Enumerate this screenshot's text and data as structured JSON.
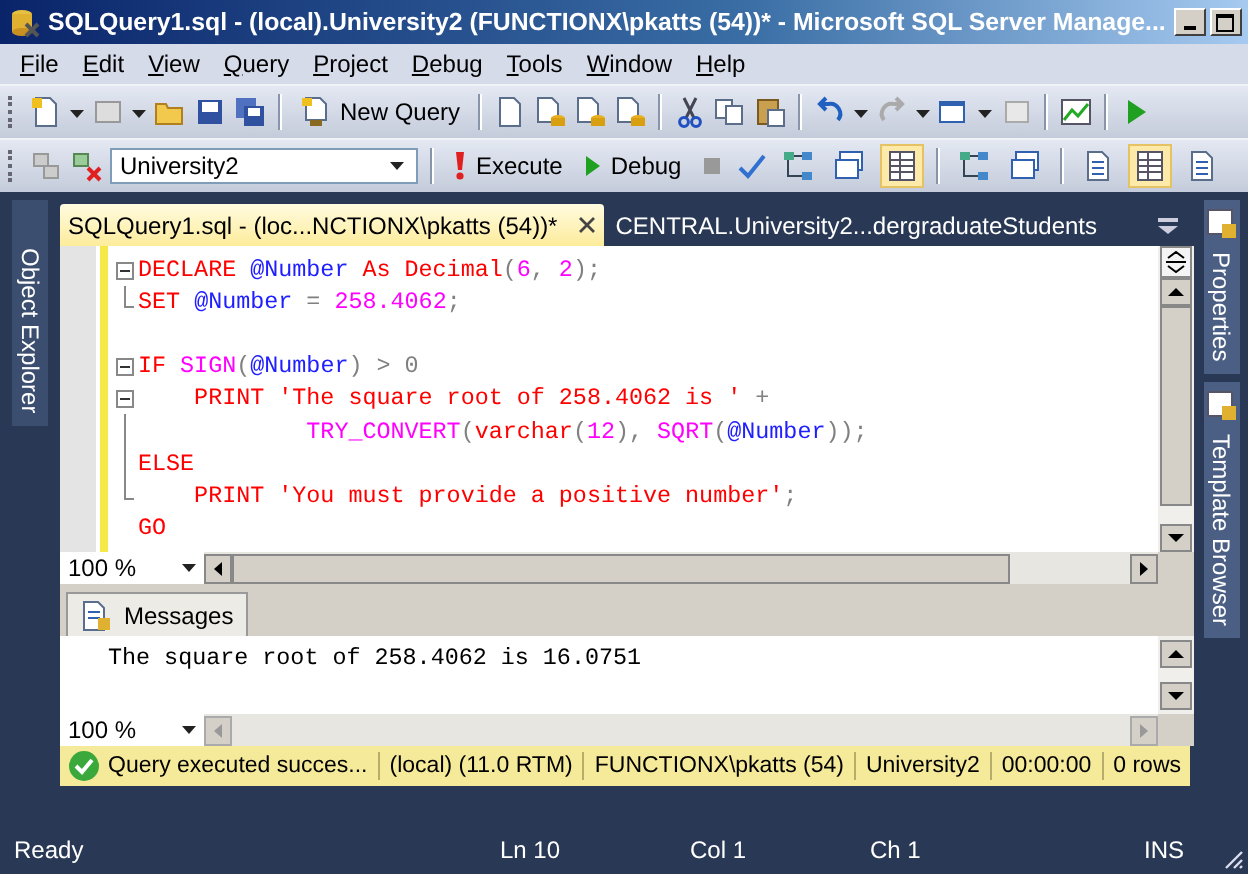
{
  "window": {
    "title": "SQLQuery1.sql - (local).University2 (FUNCTIONX\\pkatts (54))* - Microsoft SQL Server Manage..."
  },
  "menu": [
    "File",
    "Edit",
    "View",
    "Query",
    "Project",
    "Debug",
    "Tools",
    "Window",
    "Help"
  ],
  "toolbar_1": {
    "new_query": "New Query"
  },
  "toolbar_2": {
    "database": "University2",
    "execute": "Execute",
    "debug": "Debug",
    "toggles": [
      {
        "selected": false
      },
      {
        "selected": false
      },
      {
        "selected": true
      },
      {
        "selected": false
      },
      {
        "selected": false
      },
      {
        "selected": false
      },
      {
        "selected": true
      },
      {
        "selected": false
      }
    ]
  },
  "left_dock": {
    "tabs": [
      "Object Explorer"
    ]
  },
  "right_dock": {
    "tabs": [
      "Properties",
      "Template Browser"
    ]
  },
  "document_tabs": [
    {
      "label": "SQLQuery1.sql - (loc...NCTIONX\\pkatts (54))*",
      "selected": true
    },
    {
      "label": "CENTRAL.University2...dergraduateStudents",
      "selected": false
    }
  ],
  "editor": {
    "zoom": "100 %",
    "lines": [
      {
        "kind": "fold-start",
        "tokens": [
          {
            "kind": "keyword",
            "t": "DECLARE "
          },
          {
            "kind": "variable",
            "t": "@Number "
          },
          {
            "kind": "keyword",
            "t": "As Decimal"
          },
          {
            "kind": "operator",
            "t": "("
          },
          {
            "kind": "number",
            "t": "6"
          },
          {
            "kind": "operator",
            "t": ", "
          },
          {
            "kind": "number",
            "t": "2"
          },
          {
            "kind": "operator",
            "t": ");"
          }
        ]
      },
      {
        "kind": "fold-end",
        "tokens": [
          {
            "kind": "keyword",
            "t": "SET "
          },
          {
            "kind": "variable",
            "t": "@Number"
          },
          {
            "kind": "operator",
            "t": " = "
          },
          {
            "kind": "number",
            "t": "258.4062"
          },
          {
            "kind": "operator",
            "t": ";"
          }
        ]
      },
      {
        "kind": "plain"
      },
      {
        "kind": "fold-start",
        "tokens": [
          {
            "kind": "keyword",
            "t": "IF "
          },
          {
            "kind": "function",
            "t": "SIGN"
          },
          {
            "kind": "operator",
            "t": "("
          },
          {
            "kind": "variable",
            "t": "@Number"
          },
          {
            "kind": "operator",
            "t": ") > 0"
          }
        ]
      },
      {
        "kind": "fold-start",
        "tokens": [
          {
            "kind": "keyword",
            "t": "    PRINT "
          },
          {
            "kind": "string",
            "t": "'The square root of 258.4062 is '"
          },
          {
            "kind": "operator",
            "t": " +"
          }
        ]
      },
      {
        "kind": "fold-inner",
        "tokens": [
          {
            "kind": "function",
            "t": "            TRY_CONVERT"
          },
          {
            "kind": "operator",
            "t": "("
          },
          {
            "kind": "keyword",
            "t": "varchar"
          },
          {
            "kind": "operator",
            "t": "("
          },
          {
            "kind": "number",
            "t": "12"
          },
          {
            "kind": "operator",
            "t": "), "
          },
          {
            "kind": "function",
            "t": "SQRT"
          },
          {
            "kind": "operator",
            "t": "("
          },
          {
            "kind": "variable",
            "t": "@Number"
          },
          {
            "kind": "operator",
            "t": "));"
          }
        ]
      },
      {
        "kind": "fold-inner",
        "tokens": [
          {
            "kind": "keyword",
            "t": "ELSE"
          }
        ]
      },
      {
        "kind": "fold-end",
        "tokens": [
          {
            "kind": "keyword",
            "t": "    PRINT "
          },
          {
            "kind": "string",
            "t": "'You must provide a positive number'"
          },
          {
            "kind": "operator",
            "t": ";"
          }
        ]
      },
      {
        "kind": "plain",
        "tokens": [
          {
            "kind": "keyword",
            "t": "GO"
          }
        ]
      }
    ]
  },
  "messages": {
    "tab": "Messages",
    "lines": [
      "The square root of 258.4062 is 16.0751"
    ],
    "zoom": "100 %"
  },
  "query_status": {
    "items": [
      "Query executed succes...",
      "(local) (11.0 RTM)",
      "FUNCTIONX\\pkatts (54)",
      "University2",
      "00:00:00",
      "0 rows"
    ]
  },
  "status_bar": {
    "text": "Ready",
    "fields": [
      "Ln 10",
      "Col 1",
      "Ch 1",
      "INS"
    ]
  }
}
